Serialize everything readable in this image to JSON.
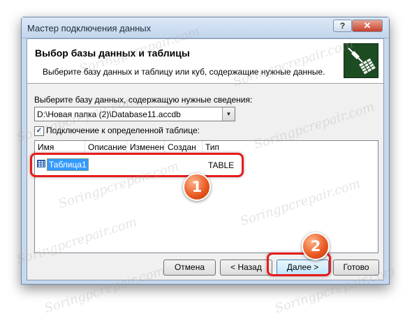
{
  "window": {
    "title": "Мастер подключения данных",
    "help_label": "?",
    "close_label": "✕"
  },
  "header": {
    "title": "Выбор базы данных и таблицы",
    "subtitle": "Выберите базу данных и таблицу или куб, содержащие нужные данные."
  },
  "database": {
    "label": "Выберите базу данных, содержащую нужные сведения:",
    "value": "D:\\Новая папка (2)\\Database11.accdb"
  },
  "connect_table": {
    "label": "Подключение к определенной таблице:",
    "checked": true,
    "mark": "✓"
  },
  "table_list": {
    "columns": [
      "Имя",
      "Описание",
      "Изменен",
      "Создан",
      "Тип"
    ],
    "rows": [
      {
        "name": "Таблица1",
        "description": "",
        "modified": "",
        "created": "",
        "type": "TABLE"
      }
    ]
  },
  "buttons": {
    "cancel": "Отмена",
    "back": "< Назад",
    "next": "Далее >",
    "finish": "Готово"
  },
  "annotations": {
    "badge1": "1",
    "badge2": "2"
  },
  "watermark": "Soringpcrepair.com",
  "colors": {
    "annotation_red": "#e81b1b",
    "badge_orange": "#e8561e",
    "selection_blue": "#3399ff"
  }
}
